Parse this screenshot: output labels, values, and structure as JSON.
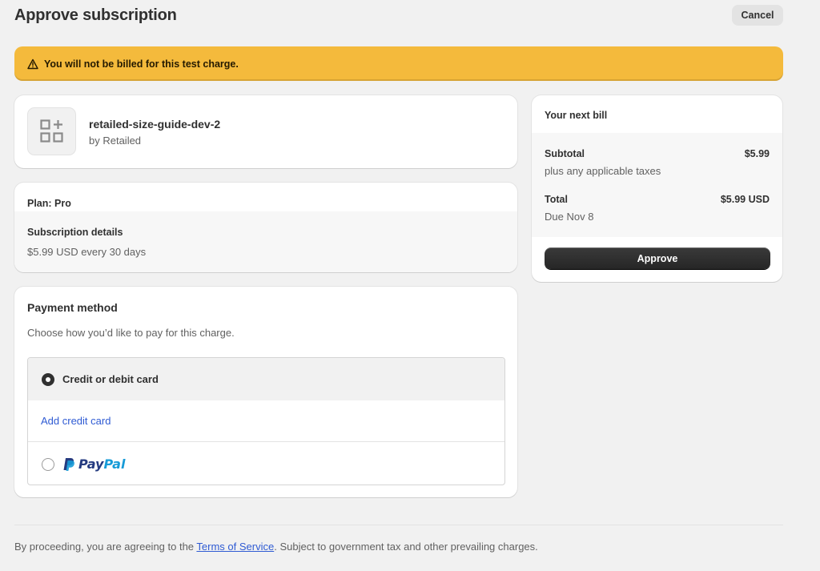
{
  "header": {
    "title": "Approve subscription",
    "cancel_label": "Cancel"
  },
  "banner": {
    "icon": "warning-icon",
    "text": "You will not be billed for this test charge.",
    "color": "#f4ba3c"
  },
  "app": {
    "icon": "apps-icon",
    "name": "retailed-size-guide-dev-2",
    "by": "by Retailed"
  },
  "plan": {
    "label": "Plan: Pro",
    "details_title": "Subscription details",
    "details_value": "$5.99 USD every 30 days"
  },
  "payment": {
    "title": "Payment method",
    "description": "Choose how you’d like to pay for this charge.",
    "options": [
      {
        "label": "Credit or debit card",
        "selected": true
      },
      {
        "label": "PayPal",
        "selected": false,
        "icon": "paypal-logo"
      }
    ],
    "add_card_label": "Add credit card",
    "paypal_parts": [
      "Pay",
      "Pal"
    ]
  },
  "bill": {
    "title": "Your next bill",
    "subtotal_label": "Subtotal",
    "subtotal_value": "$5.99",
    "subtotal_note": "plus any applicable taxes",
    "total_label": "Total",
    "total_value": "$5.99 USD",
    "total_note": "Due Nov 8",
    "approve_label": "Approve"
  },
  "footer": {
    "text_before": "By proceeding, you are agreeing to the ",
    "link": "Terms of Service",
    "text_after": ". Subject to government tax and other prevailing charges."
  },
  "colors": {
    "background": "#f1f1f1",
    "link": "#2f5bd3",
    "primary_button": "#303030"
  }
}
